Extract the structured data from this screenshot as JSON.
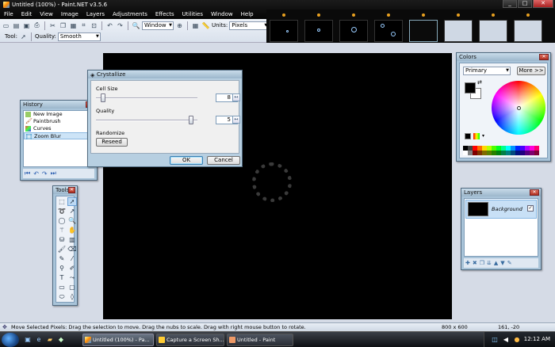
{
  "window": {
    "title": "Untitled (100%) - Paint.NET v3.5.6"
  },
  "menu": [
    "File",
    "Edit",
    "View",
    "Image",
    "Layers",
    "Adjustments",
    "Effects",
    "Utilities",
    "Window",
    "Help"
  ],
  "toolbar": {
    "window_combo": "Window",
    "units_label": "Units:",
    "units_value": "Pixels",
    "tool_label": "Tool:",
    "quality_label": "Quality:",
    "quality_value": "Smooth"
  },
  "history": {
    "title": "History",
    "items": [
      "New Image",
      "Paintbrush",
      "Curves",
      "Zoom Blur"
    ],
    "selected_index": 3
  },
  "tools": {
    "title": "Tools"
  },
  "crystallize": {
    "title": "Crystallize",
    "cell_size_label": "Cell Size",
    "cell_size_value": "8",
    "quality_label": "Quality",
    "quality_value": "5",
    "randomize_label": "Randomize",
    "reseed_label": "Reseed",
    "ok_label": "OK",
    "cancel_label": "Cancel"
  },
  "colors": {
    "title": "Colors",
    "mode": "Primary",
    "more_label": "More >>",
    "primary": "#000000",
    "secondary": "#ffffff",
    "palette": [
      "#000000",
      "#404040",
      "#ff0000",
      "#ff6a00",
      "#ffd800",
      "#b6ff00",
      "#4cff00",
      "#00ff21",
      "#00ff90",
      "#00ffff",
      "#0094ff",
      "#0026ff",
      "#4800ff",
      "#b200ff",
      "#ff00dc",
      "#ff006e",
      "#ffffff",
      "#808080",
      "#7f0000",
      "#7f3300",
      "#7f6a00",
      "#5b7f00",
      "#267f00",
      "#007f0e",
      "#007f46",
      "#007f7f",
      "#004a7f",
      "#00137f",
      "#21007f",
      "#57007f",
      "#7f006e",
      "#7f0037"
    ]
  },
  "layers": {
    "title": "Layers",
    "items": [
      {
        "name": "Background",
        "visible": true
      }
    ]
  },
  "status": {
    "text": "Move Selected Pixels: Drag the selection to move. Drag the nubs to scale. Drag with right mouse button to rotate.",
    "size": "800 x 600",
    "position": "161, -20"
  },
  "taskbar": {
    "tasks": [
      "Untitled (100%) - Pa...",
      "Capture a Screen Sh...",
      "Untitled - Paint"
    ],
    "clock": "12:12 AM"
  }
}
